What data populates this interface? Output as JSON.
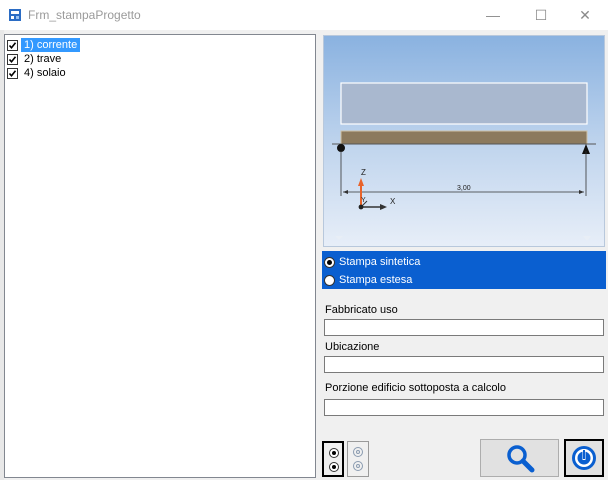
{
  "window": {
    "title": "Frm_stampaProgetto",
    "minimize_glyph": "—",
    "maximize_glyph": "☐",
    "close_glyph": "✕"
  },
  "tree": {
    "items": [
      {
        "label": "1) corrente",
        "checked": true,
        "selected": true
      },
      {
        "label": "2) trave",
        "checked": true,
        "selected": false
      },
      {
        "label": "4) solaio",
        "checked": true,
        "selected": false
      }
    ]
  },
  "preview": {
    "axis_z": "Z",
    "axis_y": "Y",
    "axis_x": "X",
    "dimension": "3,00"
  },
  "print_options": {
    "options": [
      {
        "label": "Stampa sintetica",
        "selected": true
      },
      {
        "label": "Stampa  estesa",
        "selected": false
      }
    ]
  },
  "fields": [
    {
      "label": "Fabbricato uso",
      "value": ""
    },
    {
      "label": "Ubicazione",
      "value": ""
    },
    {
      "label": "Porzione edificio sottoposta a calcolo",
      "value": ""
    }
  ],
  "colors": {
    "panel_blue": "#0a5fd0",
    "selection_blue": "#3399ff",
    "icon_blue": "#0a5fd0"
  },
  "icons": {
    "search": "magnifier-icon",
    "power": "power-icon"
  }
}
